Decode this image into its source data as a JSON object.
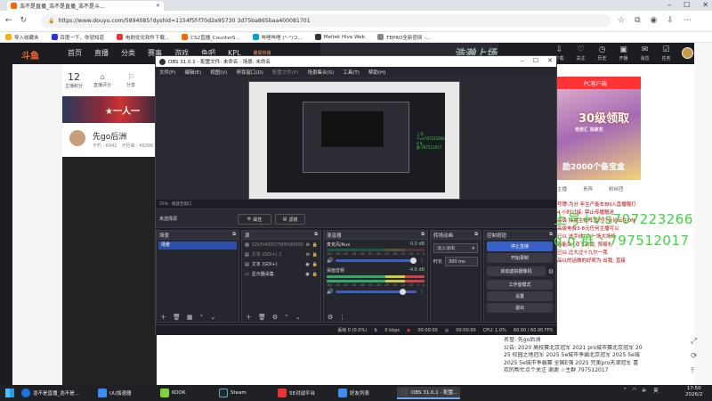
{
  "browser": {
    "tab_title": "浩不是直播_浩不是直播_浩不是斗...",
    "url": "https://www.douyu.com/5894085?dyshid=1154f5f-f70d2e95730 3d75ba865baa400081701",
    "bookmarks": [
      "导入收藏夹",
      "百度一下，你就知道",
      "电刷优化软件下载...",
      "CS2直播_CounterS...",
      "哔哩哔哩 (°-°)つ...",
      "Meltek Hive Web",
      "TEPRO全新官网 -..."
    ]
  },
  "douyu": {
    "logo": "斗鱼",
    "nav": [
      "首页",
      "直播",
      "分类",
      "赛事",
      "游戏",
      "鱼吧",
      "KPL"
    ],
    "nav_hot": "暑假热播",
    "banner_text": "浩瀚上场",
    "right_nav": [
      "下载",
      "关注",
      "历史",
      "开播",
      "消息",
      "任务"
    ],
    "stats": [
      {
        "value": "12",
        "label": "主播积分"
      },
      {
        "value": "⌂",
        "label": "直播评分"
      },
      {
        "value": "⚐",
        "label": "分享"
      }
    ],
    "ad_strip_text": "★一人一",
    "streamer_name": "先go后洲",
    "streamer_sub": "不朽 · 6942",
    "streamer_meta": "不朽斋 · 46398",
    "right_ad_label": "PC客户端",
    "promo_big": "级领取",
    "promo_sub": "30",
    "promo_line1": "奇技汇 独家奖",
    "promo_line2": "励2000个备宝盒",
    "right_labels": [
      "主播",
      "贵宾",
      "粉丝团"
    ],
    "chat_lines": [
      "号牌-为分 年生产能车BN入直播赠打",
      "4 小时过接: 禁止传播赠送",
      "高级 接播主播阵营约行会论坛在ON",
      "高级电费3-8元任何主播可以",
      "已以.选手线; 为一场大场场",
      "新能出. 双了余我; 贸易礼  ",
      "已以.过大过十九尔一我",
      "品以的话做的好呢为 出我; 直接"
    ],
    "announce": [
      "名誉: 先go后洲",
      "公告: 2020 高校赛北京冠军 2021 pro城市赛北京冠军 20",
      "25 校园之地冠军 2025 5e城市争霸北京冠军 2025 5e城",
      "2025 5e城市争霸赛 全国E强 2025 完美pro天津冠军 喜",
      "欢的帮忙点个关注 谢谢 ☆主群 797512017"
    ],
    "overlay_lines": [
      "上号+v:s707223266",
      "q q 群 : 797512017"
    ]
  },
  "obs": {
    "title": "OBS 31.0.1 - 配置文件: 未命名 - 场景: 未命名",
    "menu": [
      "文件(F)",
      "编辑(E)",
      "视图(V)",
      "停靠窗口(D)",
      "配置文件(P)",
      "场景集合(S)",
      "工具(T)",
      "帮助(H)"
    ],
    "preview_green": [
      "上号+v:s707223266",
      "q q群:797512017"
    ],
    "zoom": "25%",
    "zoom_label": "缩放至窗口",
    "no_scene": "未选择源",
    "props_label": "属性",
    "filters_label": "滤镜",
    "docks": {
      "scenes": "场景",
      "sources": "源",
      "mixer": "混音器",
      "transitions": "转场动画",
      "controls": "控制按钮"
    },
    "scene_item": "场景",
    "sources": [
      {
        "name": "32b5t40507f9f6fd000039",
        "dim": true
      },
      {
        "name": "文本 (GDI+) 2",
        "dim": true
      },
      {
        "name": "文本 (GDI+)",
        "dim": false
      },
      {
        "name": "显示器采集",
        "dim": false
      }
    ],
    "mixer": [
      {
        "name": "麦克风/Aux",
        "db": "0.0 dB"
      },
      {
        "name": "桌面音频",
        "db": "-4.6 dB"
      }
    ],
    "meter_scale": [
      "-60",
      "-55",
      "-50",
      "-45",
      "-40",
      "-35",
      "-30",
      "-25",
      "-20",
      "-15",
      "-10",
      "-5",
      "0"
    ],
    "transition": "淡入淡出",
    "duration_label": "时长",
    "duration": "300 ms",
    "controls": [
      "停止直播",
      "开始录制",
      "启动虚拟摄像机",
      "工作室模式",
      "设置",
      "退出"
    ],
    "status": {
      "dropped": "丢帧 0 (0.0%)",
      "kbps": "0 kbps",
      "live_time": "00:00:00",
      "rec_time": "00:00:00",
      "cpu": "CPU: 1.0%",
      "fps": "60.00 / 60.00 FPS"
    }
  },
  "taskbar": {
    "items": [
      {
        "label": "浩不是直播_浩不是...",
        "color": "#1a73e8",
        "active": false
      },
      {
        "label": "UU加速器",
        "color": "#3a8ef5",
        "active": false
      },
      {
        "label": "KOOK",
        "color": "#7fd43a",
        "active": false
      },
      {
        "label": "Steam",
        "color": "#1b2838",
        "active": false
      },
      {
        "label": "5E对战平台",
        "color": "#e33",
        "active": false
      },
      {
        "label": "好友列表",
        "color": "#3a8ef5",
        "active": false
      },
      {
        "label": "OBS 31.0.1 - 配置...",
        "color": "#444",
        "active": true
      }
    ],
    "tray_lang": "英",
    "time": "17:50",
    "date": "2026/2"
  }
}
